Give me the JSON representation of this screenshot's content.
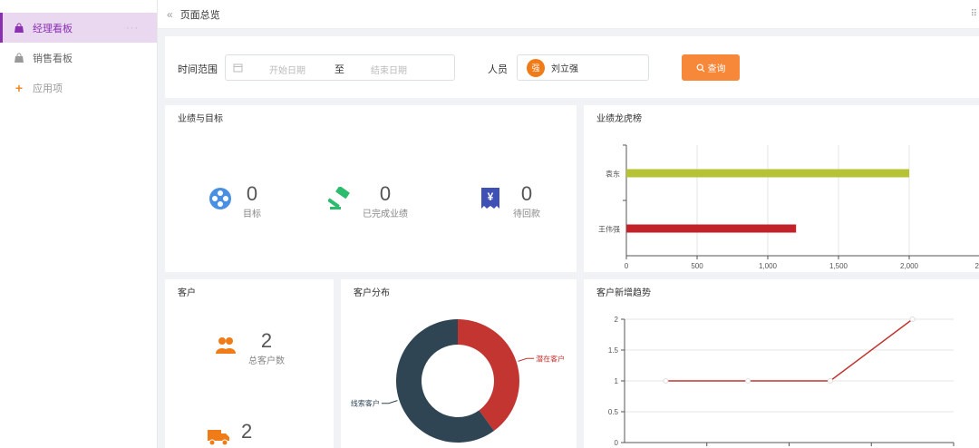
{
  "sidebar": {
    "items": [
      {
        "label": "经理看板",
        "active": true
      },
      {
        "label": "销售看板",
        "active": false
      },
      {
        "label": "应用项",
        "active": false
      }
    ],
    "more_label": "···"
  },
  "header": {
    "title": "页面总览",
    "collapse_glyph": "«",
    "dots": "⠿"
  },
  "filter": {
    "time_label": "时间范围",
    "start_placeholder": "开始日期",
    "range_sep": "至",
    "end_placeholder": "结束日期",
    "person_label": "人员",
    "avatar_text": "强",
    "person_value": "刘立强",
    "query_label": "查询"
  },
  "performance": {
    "title": "业绩与目标",
    "stats": [
      {
        "value": "0",
        "label": "目标",
        "icon": "film-reel-icon",
        "color": "#4a90e2"
      },
      {
        "value": "0",
        "label": "已完成业绩",
        "icon": "gavel-icon",
        "color": "#2dbb6e"
      },
      {
        "value": "0",
        "label": "待回款",
        "icon": "yuan-receipt-icon",
        "color": "#3f51b5"
      }
    ]
  },
  "customers": {
    "title": "客户",
    "stats": [
      {
        "value": "2",
        "label": "总客户数",
        "icon": "users-icon",
        "color": "#f07c19"
      },
      {
        "value": "2",
        "label": "",
        "icon": "truck-icon",
        "color": "#f07c19"
      }
    ]
  },
  "charts": {
    "ranking_title": "业绩龙虎榜",
    "distribution_title": "客户分布",
    "trend_title": "客户新增趋势"
  },
  "chart_data": [
    {
      "type": "bar",
      "orientation": "horizontal",
      "categories": [
        "袁东",
        "王伟强"
      ],
      "values": [
        2000,
        1200
      ],
      "colors": [
        "#b5c334",
        "#c1232b"
      ],
      "xticks": [
        "0",
        "500",
        "1,000",
        "1,500",
        "2,000",
        "2,5"
      ],
      "xlim": [
        0,
        2500
      ],
      "grid": true
    },
    {
      "type": "pie",
      "donut": true,
      "slices": [
        {
          "label": "潜在客户",
          "value": 1,
          "color": "#c23531"
        },
        {
          "label": "线索客户",
          "value": 1.5,
          "color": "#2f4554"
        }
      ]
    },
    {
      "type": "line",
      "x": [
        1,
        2,
        3,
        4
      ],
      "y": [
        1,
        1,
        1,
        2
      ],
      "yticks": [
        "0",
        "0.5",
        "1",
        "1.5",
        "2"
      ],
      "ylim": [
        0,
        2
      ],
      "color": "#c23531",
      "grid": true
    }
  ]
}
